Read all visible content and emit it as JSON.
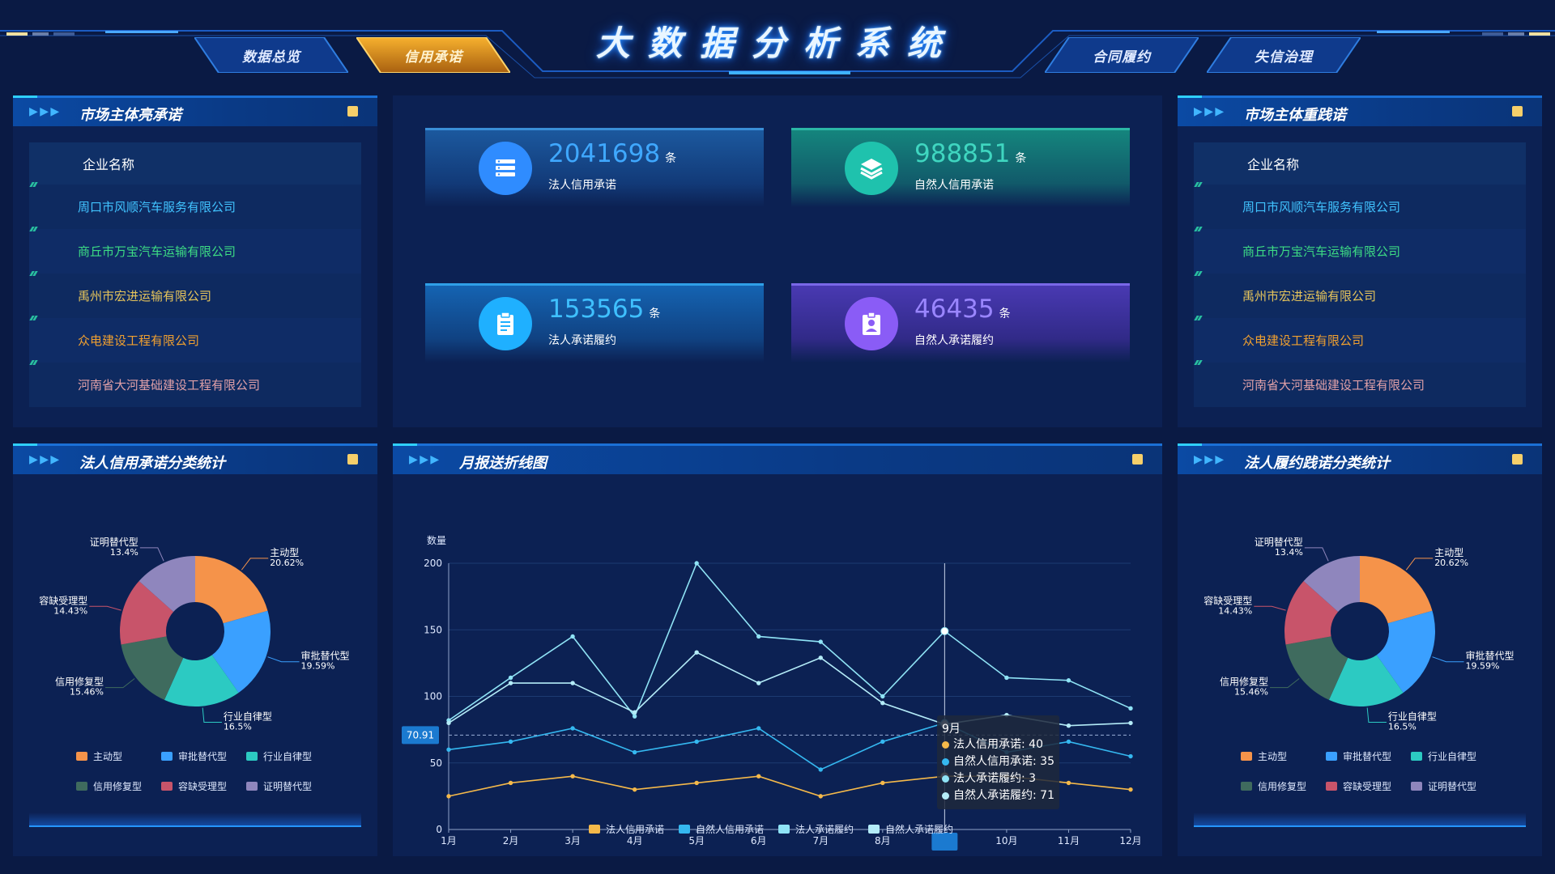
{
  "title": "大数据分析系统",
  "nav": {
    "tabs": [
      {
        "label": "数据总览",
        "active": false
      },
      {
        "label": "信用承诺",
        "active": true
      },
      {
        "label": "合同履约",
        "active": false
      },
      {
        "label": "失信治理",
        "active": false
      }
    ]
  },
  "colors": {
    "accent": "#1f8cff",
    "active_tab": "#f0a020",
    "panel": "#0c2153"
  },
  "left_top_panel": {
    "title": "市场主体亮承诺",
    "column": "企业名称",
    "companies": [
      {
        "name": "周口市风顺汽车服务有限公司",
        "color": "#41c3ff"
      },
      {
        "name": "商丘市万宝汽车运输有限公司",
        "color": "#3ddc84"
      },
      {
        "name": "禹州市宏进运输有限公司",
        "color": "#e6c45b"
      },
      {
        "name": "众电建设工程有限公司",
        "color": "#f0a030"
      },
      {
        "name": "河南省大河基础建设工程有限公司",
        "color": "#e0a0a8"
      }
    ]
  },
  "right_top_panel": {
    "title": "市场主体重践诺",
    "column": "企业名称",
    "companies": [
      {
        "name": "周口市风顺汽车服务有限公司",
        "color": "#41c3ff"
      },
      {
        "name": "商丘市万宝汽车运输有限公司",
        "color": "#3ddc84"
      },
      {
        "name": "禹州市宏进运输有限公司",
        "color": "#e6c45b"
      },
      {
        "name": "众电建设工程有限公司",
        "color": "#f0a030"
      },
      {
        "name": "河南省大河基础建设工程有限公司",
        "color": "#e0a0a8"
      }
    ]
  },
  "stats": [
    {
      "value": "2041698",
      "unit": "条",
      "label": "法人信用承诺",
      "icon": "list-icon",
      "color": "#2f9cff"
    },
    {
      "value": "988851",
      "unit": "条",
      "label": "自然人信用承诺",
      "icon": "layers-icon",
      "color": "#21c5b0"
    },
    {
      "value": "153565",
      "unit": "条",
      "label": "法人承诺履约",
      "icon": "clipboard-icon",
      "color": "#20b2ff"
    },
    {
      "value": "46435",
      "unit": "条",
      "label": "自然人承诺履约",
      "icon": "id-badge-icon",
      "color": "#8c6cff"
    }
  ],
  "chart_data": [
    {
      "type": "pie",
      "panel_title": "法人信用承诺分类统计",
      "labels": [
        "主动型",
        "审批替代型",
        "行业自律型",
        "信用修复型",
        "容缺受理型",
        "证明替代型"
      ],
      "values": [
        20.62,
        19.59,
        16.5,
        15.46,
        14.43,
        13.4
      ],
      "value_labels": [
        "20.62%",
        "19.59%",
        "16.5%",
        "15.46%",
        "14.43%",
        "13.4%"
      ],
      "colors": [
        "#f5934a",
        "#3aa0ff",
        "#2ccac2",
        "#3f6b5e",
        "#c8546a",
        "#8f86bd"
      ],
      "legend": "bottom",
      "donut": true
    },
    {
      "type": "line",
      "panel_title": "月报送折线图",
      "ylabel": "数量",
      "categories": [
        "1月",
        "2月",
        "3月",
        "4月",
        "5月",
        "6月",
        "7月",
        "8月",
        "9月",
        "10月",
        "11月",
        "12月"
      ],
      "ylim": [
        0,
        200
      ],
      "yticks": [
        0,
        50,
        100,
        150,
        200
      ],
      "series": [
        {
          "name": "法人信用承诺",
          "color": "#f5b94a",
          "values": [
            25,
            35,
            40,
            30,
            35,
            40,
            25,
            35,
            40,
            40,
            35,
            30
          ]
        },
        {
          "name": "自然人信用承诺",
          "color": "#35b8f0",
          "values": [
            60,
            66,
            76,
            58,
            66,
            76,
            45,
            66,
            80,
            58,
            66,
            55
          ]
        },
        {
          "name": "法人承诺履约",
          "color": "#8fe3f5",
          "values": [
            82,
            114,
            145,
            85,
            200,
            145,
            141,
            100,
            149,
            114,
            112,
            91
          ]
        },
        {
          "name": "自然人承诺履约",
          "color": "#b4ecf8",
          "values": [
            80,
            110,
            110,
            88,
            133,
            110,
            129,
            95,
            79,
            86,
            78,
            80
          ]
        }
      ],
      "legend": "bottom",
      "crosshair_value": "70.91",
      "tooltip": {
        "title": "9月",
        "rows": [
          {
            "text": "法人信用承诺: 40",
            "color": "#f5b94a"
          },
          {
            "text": "自然人信用承诺: 35",
            "color": "#35b8f0"
          },
          {
            "text": "法人承诺履约: 3",
            "color": "#8fe3f5"
          },
          {
            "text": "自然人承诺履约: 71",
            "color": "#b4ecf8"
          }
        ]
      }
    },
    {
      "type": "pie",
      "panel_title": "法人履约践诺分类统计",
      "labels": [
        "主动型",
        "审批替代型",
        "行业自律型",
        "信用修复型",
        "容缺受理型",
        "证明替代型"
      ],
      "values": [
        20.62,
        19.59,
        16.5,
        15.46,
        14.43,
        13.4
      ],
      "value_labels": [
        "20.62%",
        "19.59%",
        "16.5%",
        "15.46%",
        "14.43%",
        "13.4%"
      ],
      "colors": [
        "#f5934a",
        "#3aa0ff",
        "#2ccac2",
        "#3f6b5e",
        "#c8546a",
        "#8f86bd"
      ],
      "legend": "bottom",
      "donut": true
    }
  ]
}
